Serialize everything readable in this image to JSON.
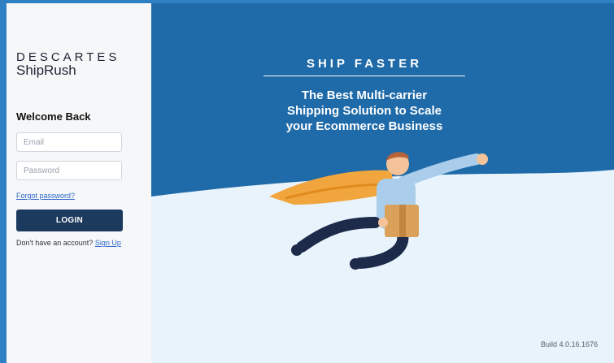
{
  "brand": {
    "company": "DESCARTES",
    "product": "ShipRush"
  },
  "login": {
    "welcome": "Welcome Back",
    "email_placeholder": "Email",
    "password_placeholder": "Password",
    "forgot_link": "Forgot password?",
    "login_button": "LOGIN",
    "signup_prompt": "Don't have an account?",
    "signup_link": "Sign Up"
  },
  "hero": {
    "tagline": "SHIP FASTER",
    "headline_lines": [
      "The Best Multi-carrier",
      "Shipping Solution to Scale",
      "your Ecommerce Business"
    ],
    "build": "Build 4.0.16.1676"
  },
  "colors": {
    "accent": "#2f7fc3",
    "hero_bg": "#1f6aa8",
    "button_bg": "#1c3a5e",
    "link": "#2f67c9"
  }
}
